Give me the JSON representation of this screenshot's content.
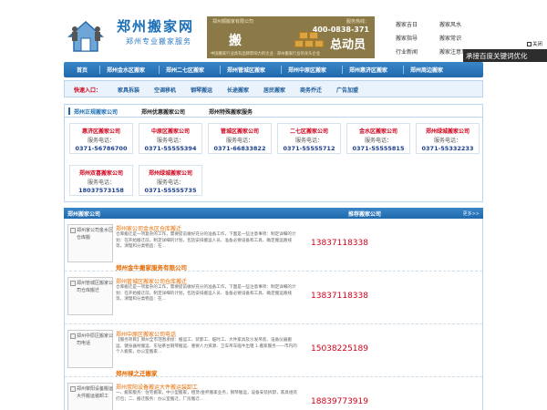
{
  "logo": {
    "title": "郑州搬家网",
    "subtitle": "郑州专业搬家服务"
  },
  "banner": {
    "top": "郑州顺搬家有限公司",
    "hotline": "服务热线：",
    "phone": "400-0838-371",
    "word_move": "搬",
    "word_big": "总动员",
    "bottom": "中国搬家行业具有品牌影响力的企业 · 郑州搬家行业的龙头企业"
  },
  "top_links": [
    "搬家吉日",
    "搬家风水",
    "搬家指导",
    "搬家常识",
    "行业新闻",
    "搬家注意事项"
  ],
  "nav": [
    "首页",
    "郑州金水区搬家",
    "郑州二七区搬家",
    "郑州管城区搬家",
    "郑州中原区搬家",
    "郑州惠济区搬家",
    "郑州周边搬家"
  ],
  "quick": {
    "label": "快速入口：",
    "items": [
      "家具拆装",
      "空调移机",
      "钢琴搬运",
      "长途搬家",
      "居民搬家",
      "商务乔迁",
      "广告加盟"
    ]
  },
  "tabs": [
    "郑州正规搬家公司",
    "郑州优惠搬家公司",
    "郑州特殊搬家服务"
  ],
  "companies": [
    {
      "name": "惠济区搬家公司",
      "label": "服务电话：",
      "phone": "0371-56786700"
    },
    {
      "name": "中原区搬家公司",
      "label": "服务电话：",
      "phone": "0371-55555394"
    },
    {
      "name": "管城区搬家公司",
      "label": "服务电话：",
      "phone": "0371-66833822"
    },
    {
      "name": "二七区搬家公司",
      "label": "服务电话：",
      "phone": "0371-55555712"
    },
    {
      "name": "金水区搬家公司",
      "label": "服务电话：",
      "phone": "0371-55555815"
    },
    {
      "name": "郑州绿城搬家公司",
      "label": "服务电话：",
      "phone": "0371-55332233"
    },
    {
      "name": "郑州双喜搬家公司",
      "label": "服务电话：",
      "phone": "18037573158"
    },
    {
      "name": "郑州绿城搬家公司",
      "label": "服务电话：",
      "phone": "0371-55555735"
    }
  ],
  "listing": {
    "left_title": "郑州搬家公司",
    "right_title": "推荐搬家公司",
    "more": "更多>>",
    "items": [
      {
        "thumb": "郑州家公司金水区仓库搬",
        "title": "郑州家公司金水区仓库搬迁",
        "desc": "仓库搬迁是一项复杂的工作，需要提前做好充分的准备工作，下面是一些注意事项：制定详细的计划：在开始搬迁前，制定详细的计划，包括安排搬运人员、准备必要设备和工具、确定搬运路线等。清理和分类物品：在...",
        "company": "郑州金牛搬家服务有限公司",
        "phone": "13837118338"
      },
      {
        "thumb": "郑州管城区搬家公司仓库搬迁",
        "title": "郑州管城区搬家公司仓库搬迁",
        "desc": "仓库搬迁是一项复杂的工作，需要提前做好充分的准备工作，下面是一些注意事项：制定详细的计划：在开始搬迁前，制定详细的计划，包括安排搬运人员、准备必要设备和工具、确定搬运路线等。清理和分类物品：在...",
        "company": "",
        "phone": "13837118338"
      },
      {
        "thumb": "郑州中原区搬家公司电话",
        "title": "郑州中原区搬家公司电话",
        "desc": "【服务项目】郑州全市范围承接：搬运工、装卸工、临时工、大件家具及沙发吊装、设备仪器搬运、健身器材搬运、东钻茶台钢琴搬运、重要人力资源、卫车吊车临牛出租 1.搬家服务——市内的个人搬家，办公室搬家...",
        "company": "郑州禄之迁搬家",
        "phone": "15038225189"
      },
      {
        "thumb": "郑州荥阳设备搬运大件搬运装卸工",
        "title": "郑州荥阳设备搬运大件搬运装卸工",
        "desc": "一、搬家服务：住宅搬家，中小型搬家，租赁/金杯搬家业务，钢琴搬运，设备安装拆卸，家具组装打包；二、搬迁服务：办公室搬迁，厂房搬迁...",
        "company": "",
        "phone": "18839773919"
      }
    ]
  },
  "overlay": {
    "close": "关闭",
    "banner": "承接百度关键词优化"
  }
}
